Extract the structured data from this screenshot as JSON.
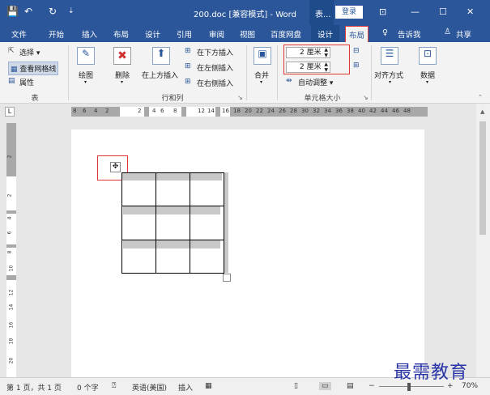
{
  "titlebar": {
    "quick_access": [
      "💾",
      "↶",
      "↻",
      "⇣"
    ],
    "title": "200.doc [兼容模式] - Word",
    "context_tab": "表...",
    "login": "登录",
    "ribbon_display": "⊡",
    "minimize": "—",
    "restore": "☐",
    "close": "✕"
  },
  "tabs": [
    {
      "label": "文件"
    },
    {
      "label": "开始"
    },
    {
      "label": "插入"
    },
    {
      "label": "布局"
    },
    {
      "label": "设计"
    },
    {
      "label": "引用"
    },
    {
      "label": "审阅"
    },
    {
      "label": "视图"
    },
    {
      "label": "百度网盘"
    },
    {
      "label": "设计"
    },
    {
      "label": "布局"
    },
    {
      "label": "告诉我"
    },
    {
      "label": "共享"
    }
  ],
  "tab_icons": {
    "tell_me": "♀",
    "share": "♙"
  },
  "ribbon": {
    "table": {
      "select": "选择 ▾",
      "view_gridlines": "查看网格线",
      "properties": "属性",
      "label": "表"
    },
    "draw": {
      "label": "绘图"
    },
    "delete": {
      "label": "删除"
    },
    "rows_cols": {
      "insert_above": "在上方插入",
      "insert_below": "在下方插入",
      "insert_left": "在左侧插入",
      "insert_right": "在右侧插入",
      "label": "行和列"
    },
    "merge": {
      "label": "合并"
    },
    "cell_size": {
      "height_value": "2 厘米",
      "width_value": "2 厘米",
      "autofit": "自动调整 ▾",
      "label": "单元格大小"
    },
    "alignment": {
      "label": "对齐方式"
    },
    "data": {
      "label": "数据"
    },
    "launcher": "↘"
  },
  "ruler": {
    "corner": "L",
    "h_ticks": [
      "8",
      "6",
      "4",
      "2",
      "",
      "2",
      "4",
      "6",
      "8",
      "",
      "12",
      "14",
      "16",
      "18",
      "20",
      "22",
      "24",
      "26",
      "28",
      "30",
      "32",
      "34",
      "36",
      "38",
      "40",
      "42",
      "44",
      "46",
      "48"
    ],
    "v_ticks": [
      "2",
      "",
      "2",
      "4",
      "6",
      "8",
      "10",
      "12",
      "14",
      "16",
      "18",
      "20",
      "22"
    ]
  },
  "table_handle": "✥",
  "table": {
    "rows": 3,
    "cols": 3
  },
  "status": {
    "page": "第 1 页，共 1 页",
    "words": "0 个字",
    "proof_icon": "⍰",
    "language": "英语(美国)",
    "mode": "插入",
    "macro_icon": "▦",
    "zoom": "70%"
  },
  "watermark": "最需教育"
}
